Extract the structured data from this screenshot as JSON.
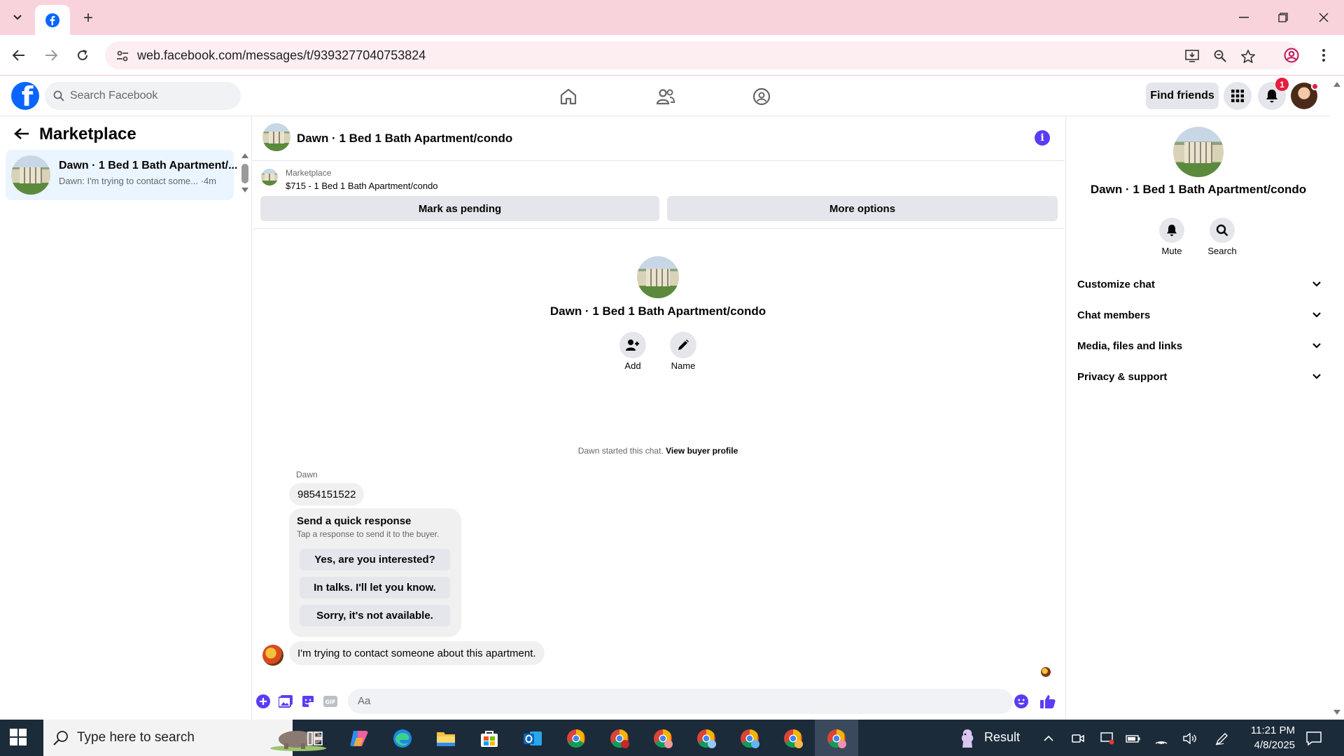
{
  "browser": {
    "url": "web.facebook.com/messages/t/9393277040753824"
  },
  "facebook": {
    "search_placeholder": "Search Facebook",
    "find_friends": "Find friends",
    "notification_count": "1"
  },
  "left_panel": {
    "title": "Marketplace",
    "conversations": [
      {
        "name": "Dawn · 1 Bed 1 Bath Apartment/...",
        "preview": "Dawn: I'm trying to contact some... ·4m"
      }
    ]
  },
  "chat": {
    "title": "Dawn · 1 Bed 1 Bath Apartment/condo",
    "marketplace_label": "Marketplace",
    "listing": "$715 - 1 Bed 1 Bath Apartment/condo",
    "mark_pending": "Mark as pending",
    "more_options": "More options",
    "center_name": "Dawn · 1 Bed 1 Bath Apartment/condo",
    "add_label": "Add",
    "name_label": "Name",
    "started_text": "Dawn started this chat.",
    "buyer_profile_link": "View buyer profile",
    "sender_name": "Dawn",
    "message_1": "9854151522",
    "quick_response": {
      "title": "Send a quick response",
      "subtitle": "Tap a response to send it to the buyer.",
      "options": [
        "Yes, are you interested?",
        "In talks. I'll let you know.",
        "Sorry, it's not available."
      ]
    },
    "message_2": "I'm trying to contact someone about this apartment.",
    "composer_placeholder": "Aa"
  },
  "right_panel": {
    "name": "Dawn · 1 Bed 1 Bath Apartment/condo",
    "mute_label": "Mute",
    "search_label": "Search",
    "sections": [
      "Customize chat",
      "Chat members",
      "Media, files and links",
      "Privacy & support"
    ]
  },
  "taskbar": {
    "search_placeholder": "Type here to search",
    "widget_label": "Result",
    "time": "11:21 PM",
    "date": "4/8/2025"
  },
  "colors": {
    "fb_blue": "#0866ff",
    "tab_strip": "#f9d3dc",
    "accent_purple": "#5b3cf5",
    "active_item_bg": "#ebf5ff",
    "badge_red": "#e41e3f"
  }
}
